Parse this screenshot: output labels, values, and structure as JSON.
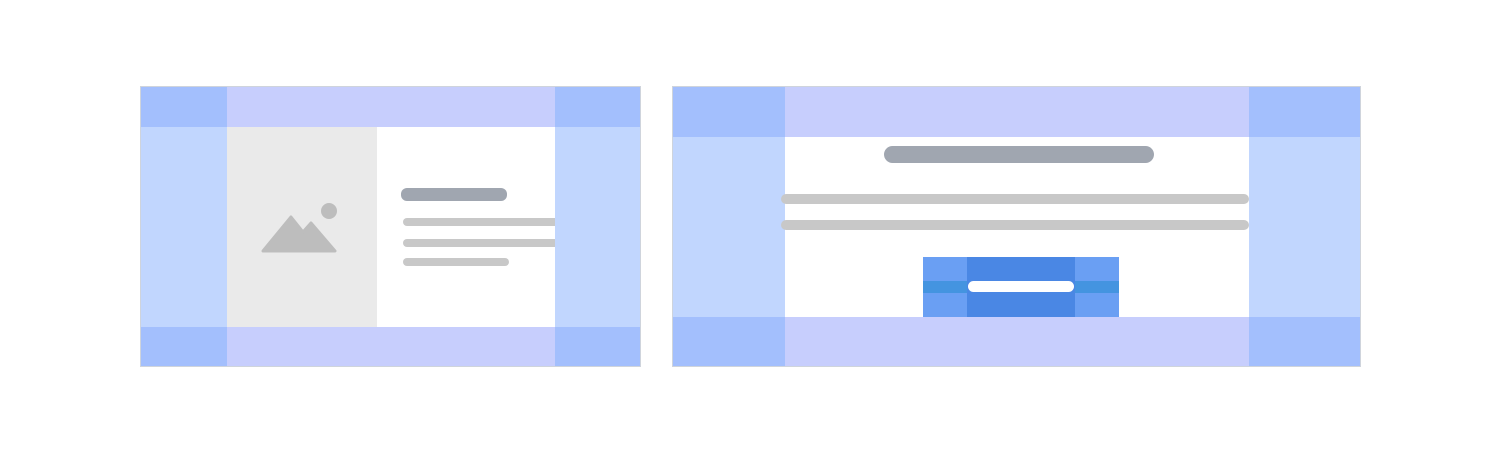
{
  "colors": {
    "corner": "#a3bffd",
    "edge_horizontal": "#c7cefd",
    "edge_vertical": "#c1d6fe",
    "media_background": "#eaeaea",
    "image_placeholder": "#bdbdbd",
    "title_line": "#a0a6b0",
    "text_line": "#c8c8c8",
    "button_padding": "#6a9ff3",
    "button_core": "#4a87e4",
    "button_row_band": "#4494e0",
    "button_label_pill": "#ffffff"
  },
  "icons": {
    "image_placeholder": "image-placeholder-icon"
  }
}
